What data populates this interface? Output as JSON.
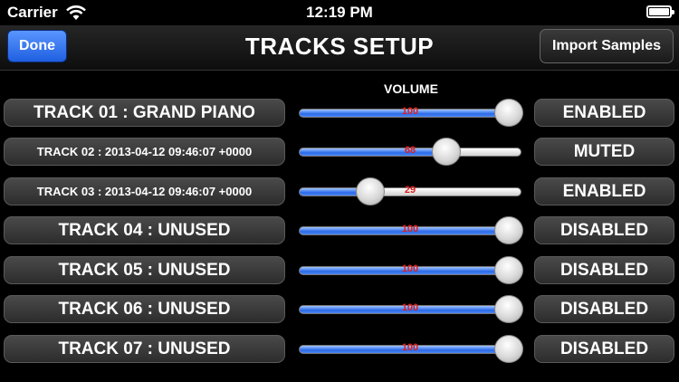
{
  "status_bar": {
    "carrier": "Carrier",
    "time": "12:19 PM",
    "wifi_icon": "wifi-icon",
    "battery_icon": "battery-icon"
  },
  "nav": {
    "title": "TRACKS SETUP",
    "done_label": "Done",
    "import_label": "Import Samples",
    "done_color": "#2f6cf0"
  },
  "volume_header": "VOLUME",
  "colors": {
    "slider_fill": "#2a6ae8",
    "slider_value_text": "#e11d1d"
  },
  "tracks": [
    {
      "name": "TRACK 01 : GRAND PIANO",
      "volume": 100,
      "volume_label": "100",
      "status": "ENABLED"
    },
    {
      "name": "TRACK 02 : 2013-04-12 09:46:07 +0000",
      "volume": 68,
      "volume_label": "68",
      "status": "MUTED"
    },
    {
      "name": "TRACK 03 : 2013-04-12 09:46:07 +0000",
      "volume": 29,
      "volume_label": "29",
      "status": "ENABLED"
    },
    {
      "name": "TRACK 04 : UNUSED",
      "volume": 100,
      "volume_label": "100",
      "status": "DISABLED"
    },
    {
      "name": "TRACK 05 : UNUSED",
      "volume": 100,
      "volume_label": "100",
      "status": "DISABLED"
    },
    {
      "name": "TRACK 06 : UNUSED",
      "volume": 100,
      "volume_label": "100",
      "status": "DISABLED"
    },
    {
      "name": "TRACK 07 : UNUSED",
      "volume": 100,
      "volume_label": "100",
      "status": "DISABLED"
    }
  ]
}
